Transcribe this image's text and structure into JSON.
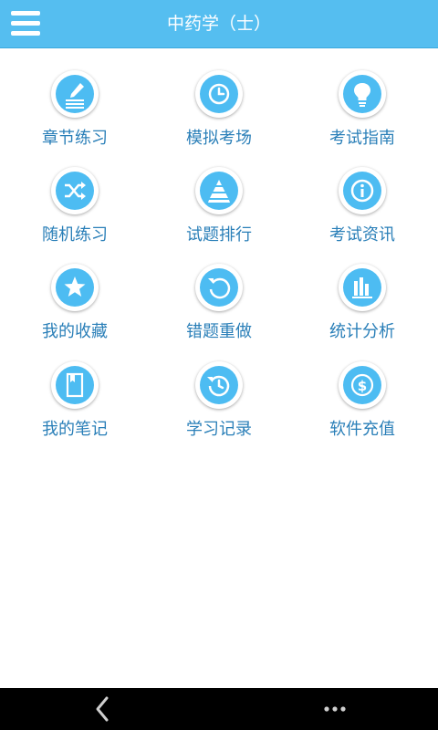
{
  "header": {
    "title": "中药学（士）",
    "menu_icon": "menu-icon",
    "color": "#55bef0"
  },
  "grid": {
    "items": [
      {
        "label": "章节练习",
        "icon": "edit-lines-icon"
      },
      {
        "label": "模拟考场",
        "icon": "clock-icon"
      },
      {
        "label": "考试指南",
        "icon": "lightbulb-icon"
      },
      {
        "label": "随机练习",
        "icon": "shuffle-icon"
      },
      {
        "label": "试题排行",
        "icon": "pyramid-icon"
      },
      {
        "label": "考试资讯",
        "icon": "info-icon"
      },
      {
        "label": "我的收藏",
        "icon": "star-icon"
      },
      {
        "label": "错题重做",
        "icon": "redo-icon"
      },
      {
        "label": "统计分析",
        "icon": "bar-chart-icon"
      },
      {
        "label": "我的笔记",
        "icon": "notebook-icon"
      },
      {
        "label": "学习记录",
        "icon": "history-icon"
      },
      {
        "label": "软件充值",
        "icon": "dollar-icon"
      }
    ],
    "icon_color": "#4dbcf2",
    "label_color": "#2a7fb8"
  },
  "navbar": {
    "back_icon": "back-chevron-icon",
    "more_icon": "more-dots-icon"
  }
}
